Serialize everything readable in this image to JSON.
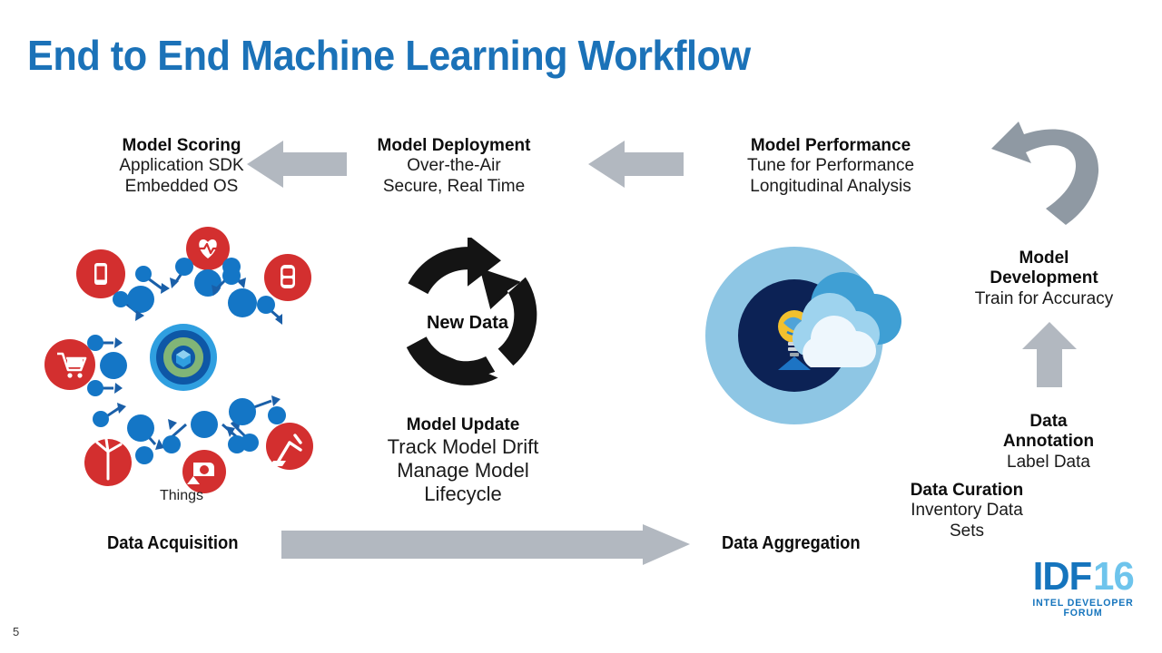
{
  "slide": {
    "title": "End to End Machine Learning Workflow",
    "page_number": "5",
    "accent_blue": "#1b72b8",
    "arrow_gray": "#b2b8c0",
    "text_black": "#111111"
  },
  "stages": {
    "model_scoring": {
      "header": "Model Scoring",
      "line1": "Application SDK",
      "line2": "Embedded OS"
    },
    "model_deployment": {
      "header": "Model Deployment",
      "line1": "Over-the-Air",
      "line2": "Secure, Real Time"
    },
    "model_performance": {
      "header": "Model Performance",
      "line1": "Tune for Performance",
      "line2": "Longitudinal Analysis"
    },
    "model_development": {
      "header_line1": "Model",
      "header_line2": "Development",
      "line1": "Train for Accuracy"
    },
    "data_annotation": {
      "header_line1": "Data",
      "header_line2": "Annotation",
      "line1": "Label Data"
    },
    "data_curation": {
      "header": "Data Curation",
      "line1": "Inventory Data",
      "line2": "Sets"
    },
    "model_update": {
      "header": "Model Update",
      "line1": "Track Model Drift",
      "line2": "Manage Model",
      "line3": "Lifecycle"
    },
    "new_data": {
      "label": "New Data"
    }
  },
  "labels": {
    "things": "Things",
    "data_acquisition": "Data Acquisition",
    "data_aggregation": "Data Aggregation"
  },
  "logo": {
    "mark_primary": "IDF",
    "mark_secondary": "16",
    "tagline": "INTEL DEVELOPER FORUM"
  },
  "icons": {
    "things_items": [
      "smartphone-icon",
      "heartbeat-icon",
      "car-icon",
      "shopping-cart-icon",
      "globe-cube-icon",
      "wind-turbine-icon",
      "camera-icon",
      "robot-arm-icon"
    ],
    "cloud": "cloud-icon",
    "lightbulb": "lightbulb-icon",
    "recycle": "circular-arrows-icon"
  }
}
